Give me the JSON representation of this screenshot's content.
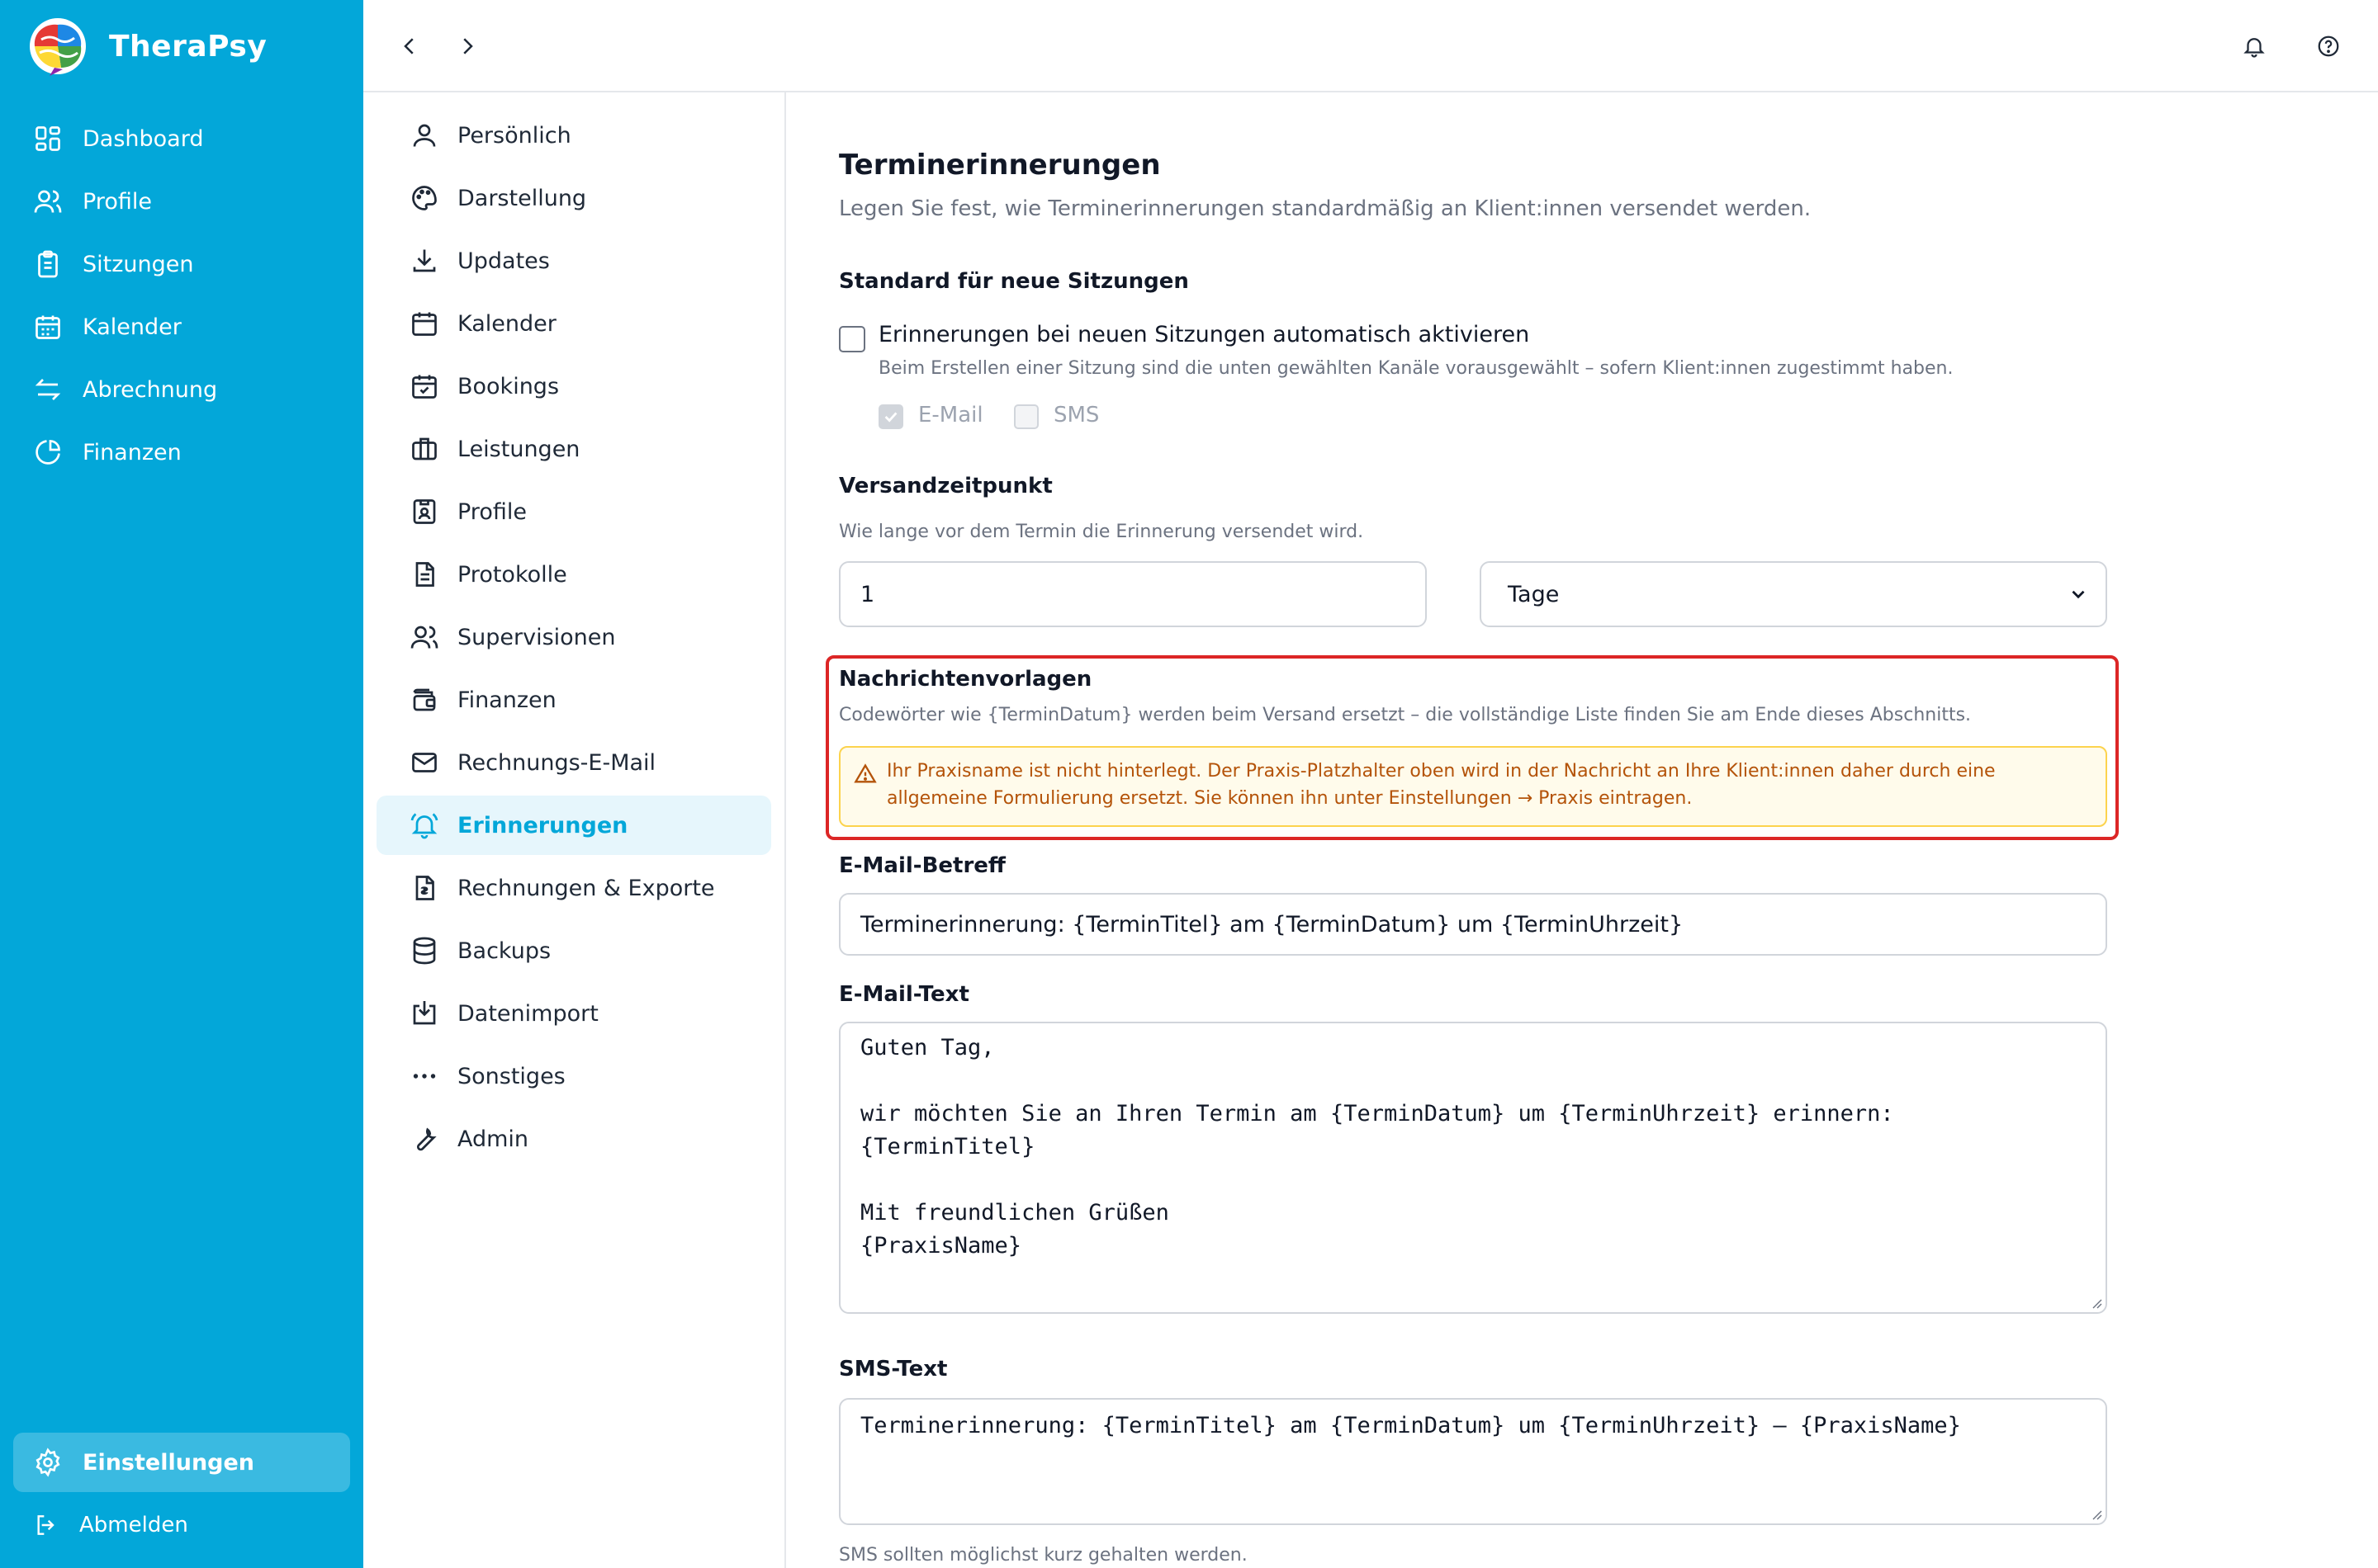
{
  "app": {
    "name": "TheraPsy"
  },
  "sidebar": {
    "items": [
      {
        "label": "Dashboard",
        "icon": "dashboard-icon"
      },
      {
        "label": "Profile",
        "icon": "users-icon"
      },
      {
        "label": "Sitzungen",
        "icon": "clipboard-icon"
      },
      {
        "label": "Kalender",
        "icon": "calendar-icon"
      },
      {
        "label": "Abrechnung",
        "icon": "arrows-exchange-icon"
      },
      {
        "label": "Finanzen",
        "icon": "pie-chart-icon"
      }
    ],
    "active": {
      "label": "Einstellungen",
      "icon": "gear-icon"
    },
    "logout": {
      "label": "Abmelden",
      "icon": "logout-icon"
    }
  },
  "topbar": {
    "back_icon": "chevron-left-icon",
    "forward_icon": "chevron-right-icon",
    "bell_icon": "bell-icon",
    "help_icon": "help-circle-icon"
  },
  "settings_menu": {
    "items": [
      {
        "label": "Persönlich",
        "icon": "user-icon"
      },
      {
        "label": "Darstellung",
        "icon": "palette-icon"
      },
      {
        "label": "Updates",
        "icon": "download-icon"
      },
      {
        "label": "Kalender",
        "icon": "calendar-icon"
      },
      {
        "label": "Bookings",
        "icon": "calendar-check-icon"
      },
      {
        "label": "Leistungen",
        "icon": "briefcase-icon"
      },
      {
        "label": "Profile",
        "icon": "id-badge-icon"
      },
      {
        "label": "Protokolle",
        "icon": "document-icon"
      },
      {
        "label": "Supervisionen",
        "icon": "users-icon"
      },
      {
        "label": "Finanzen",
        "icon": "wallet-icon"
      },
      {
        "label": "Rechnungs-E-Mail",
        "icon": "mail-icon"
      },
      {
        "label": "Erinnerungen",
        "icon": "bell-ring-icon"
      },
      {
        "label": "Rechnungen & Exporte",
        "icon": "invoice-icon"
      },
      {
        "label": "Backups",
        "icon": "database-icon"
      },
      {
        "label": "Datenimport",
        "icon": "import-icon"
      },
      {
        "label": "Sonstiges",
        "icon": "more-horizontal-icon"
      },
      {
        "label": "Admin",
        "icon": "wrench-icon"
      }
    ],
    "active_label": "Erinnerungen"
  },
  "main": {
    "title": "Terminerinnerungen",
    "subtitle": "Legen Sie fest, wie Terminerinnerungen standardmäßig an Klient:innen versendet werden.",
    "defaults": {
      "heading": "Standard für neue Sitzungen",
      "auto_label": "Erinnerungen bei neuen Sitzungen automatisch aktivieren",
      "auto_help": "Beim Erstellen einer Sitzung sind die unten gewählten Kanäle vorausgewählt – sofern Klient:innen zugestimmt haben.",
      "auto_checked": false,
      "email_label": "E-Mail",
      "email_checked": true,
      "sms_label": "SMS",
      "sms_checked": false
    },
    "timing": {
      "heading": "Versandzeitpunkt",
      "help": "Wie lange vor dem Termin die Erinnerung versendet wird.",
      "value": "1",
      "unit": "Tage"
    },
    "templates": {
      "heading": "Nachrichtenvorlagen",
      "help": "Codewörter wie {TerminDatum} werden beim Versand ersetzt – die vollständige Liste finden Sie am Ende dieses Abschnitts.",
      "warning_line1": "Ihr Praxisname ist nicht hinterlegt. Der Praxis-Platzhalter oben wird in der Nachricht an Ihre Klient:innen daher durch eine",
      "warning_line2": "allgemeine Formulierung ersetzt. Sie können ihn unter Einstellungen → Praxis eintragen.",
      "warning_icon": "warning-triangle-icon"
    },
    "email_subject": {
      "label": "E-Mail-Betreff",
      "value": "Terminerinnerung: {TerminTitel} am {TerminDatum} um {TerminUhrzeit}"
    },
    "email_text": {
      "label": "E-Mail-Text",
      "value": "Guten Tag,\n\nwir möchten Sie an Ihren Termin am {TerminDatum} um {TerminUhrzeit} erinnern:\n{TerminTitel}\n\nMit freundlichen Grüßen\n{PraxisName}"
    },
    "sms_text": {
      "label": "SMS-Text",
      "value": "Terminerinnerung: {TerminTitel} am {TerminDatum} um {TerminUhrzeit} – {PraxisName}",
      "help": "SMS sollten möglichst kurz gehalten werden."
    }
  },
  "colors": {
    "brand": "#03a7d9",
    "active_bg": "#e6f6fc",
    "warning_text": "#b45309",
    "highlight": "#dc2626"
  }
}
